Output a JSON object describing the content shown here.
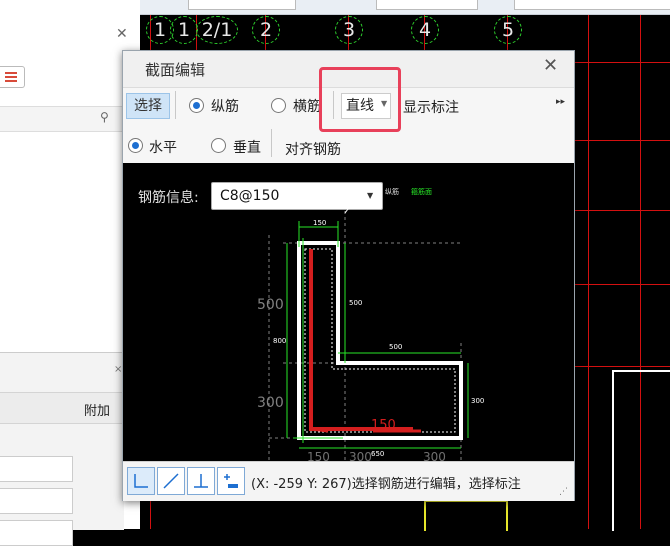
{
  "dialog": {
    "title": "截面编辑",
    "close_icon": "close-icon"
  },
  "toolbar1": {
    "select_label": "选择",
    "longitudinal_label": "纵筋",
    "transverse_label": "横筋",
    "line_type_value": "直线",
    "show_annotation_label": "显示标注"
  },
  "toolbar2": {
    "horizontal_label": "水平",
    "vertical_label": "垂直",
    "align_label": "对齐钢筋"
  },
  "rebar": {
    "label": "钢筋信息:",
    "value": "C8@150",
    "tag_a": "纵筋",
    "tag_b": "箍筋面"
  },
  "drawing": {
    "dims": [
      "150",
      "500",
      "800",
      "500",
      "300",
      "150",
      "650",
      "150",
      "300",
      "300"
    ],
    "grey_dims": [
      "500",
      "300"
    ]
  },
  "status": {
    "text": "(X: -259 Y: 267)选择钢筋进行编辑，选择标注"
  },
  "background": {
    "axis_labels": [
      "1",
      "1",
      "2/1",
      "2",
      "3",
      "4",
      "5"
    ],
    "lower_panel_column": "附加"
  },
  "colors": {
    "highlight": "#e8405a",
    "cad_grid": "#d31010",
    "selected_rebar": "#d41e1e",
    "dimension": "#27e627",
    "section_outline": "#ffffff"
  }
}
